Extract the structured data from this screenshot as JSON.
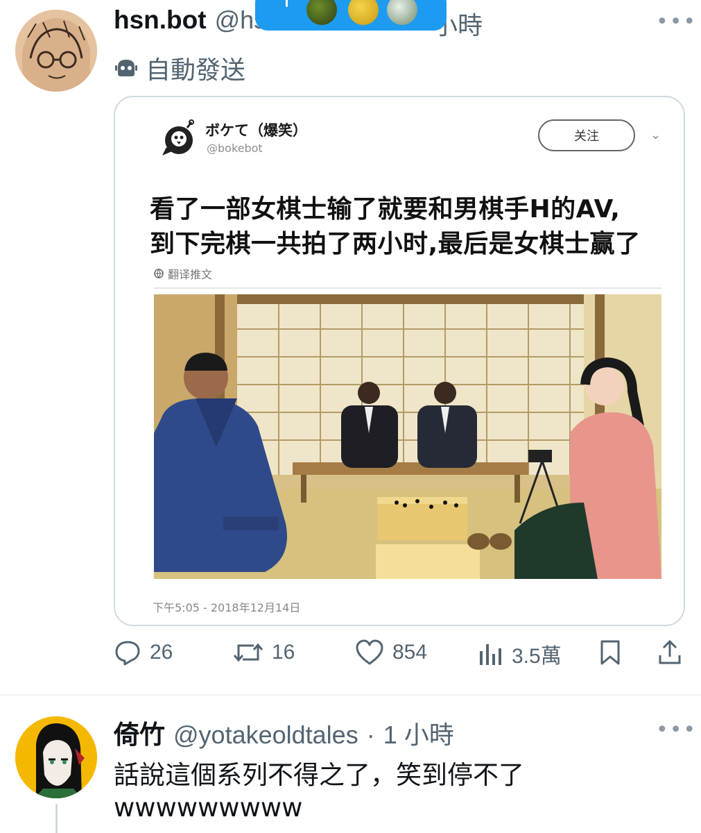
{
  "overlay": {
    "label": "new posts avatars"
  },
  "tweet": {
    "name": "hsn.bot",
    "handle_visible": "@hs",
    "time_fragment": "小時",
    "auto_label": "自動發送",
    "more_label": "•••"
  },
  "quoted": {
    "name": "ボケて（爆笑）",
    "handle": "@bokebot",
    "follow_label": "关注",
    "chevron": "⌄",
    "text_line1": "看了一部女棋士输了就要和男棋手H的AV,",
    "text_line2": "到下完棋一共拍了两小时,最后是女棋士赢了",
    "translate_label": "翻译推文",
    "timestamp": "下午5:05 - 2018年12月14日"
  },
  "actions": {
    "reply_count": "26",
    "retweet_count": "16",
    "like_count": "854",
    "views_count": "3.5萬"
  },
  "reply": {
    "name": "倚竹",
    "handle": "@yotakeoldtales",
    "dot": "·",
    "time": "1 小時",
    "more_label": "•••",
    "text_line1": "話說這個系列不得之了，笑到停不了",
    "text_line2": "wwwwwwwww"
  },
  "colors": {
    "accent": "#1d9bf0",
    "muted": "#536471",
    "border": "#cfd9de"
  },
  "icons": [
    "bot-icon",
    "globe-icon",
    "reply-icon",
    "retweet-icon",
    "like-icon",
    "views-icon",
    "bookmark-icon",
    "share-icon"
  ]
}
